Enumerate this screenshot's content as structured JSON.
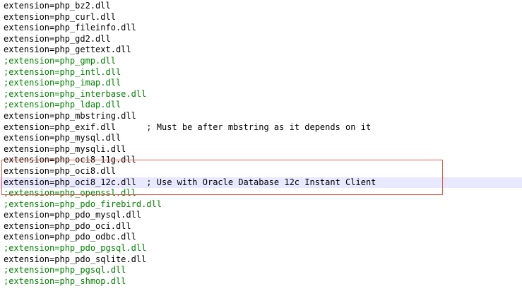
{
  "editor": {
    "lines": [
      {
        "text": "extension=php_bz2.dll",
        "comment": false
      },
      {
        "text": "extension=php_curl.dll",
        "comment": false
      },
      {
        "text": "extension=php_fileinfo.dll",
        "comment": false
      },
      {
        "text": "extension=php_gd2.dll",
        "comment": false
      },
      {
        "text": "extension=php_gettext.dll",
        "comment": false
      },
      {
        "text": ";extension=php_gmp.dll",
        "comment": true
      },
      {
        "text": ";extension=php_intl.dll",
        "comment": true
      },
      {
        "text": ";extension=php_imap.dll",
        "comment": true
      },
      {
        "text": ";extension=php_interbase.dll",
        "comment": true
      },
      {
        "text": ";extension=php_ldap.dll",
        "comment": true
      },
      {
        "text": "extension=php_mbstring.dll",
        "comment": false
      },
      {
        "text": "extension=php_exif.dll      ; Must be after mbstring as it depends on it",
        "comment": false
      },
      {
        "text": "extension=php_mysql.dll",
        "comment": false
      },
      {
        "text": "extension=php_mysqli.dll",
        "comment": false
      },
      {
        "text": "extension=php_oci8_11g.dll",
        "comment": false
      },
      {
        "text": "extension=php_oci8.dll",
        "comment": false
      },
      {
        "text": "extension=php_oci8_12c.dll  ; Use with Oracle Database 12c Instant Client",
        "comment": false,
        "current": true
      },
      {
        "text": ";extension=php_openssl.dll",
        "comment": true
      },
      {
        "text": ";extension=php_pdo_firebird.dll",
        "comment": true
      },
      {
        "text": "extension=php_pdo_mysql.dll",
        "comment": false
      },
      {
        "text": "extension=php_pdo_oci.dll",
        "comment": false
      },
      {
        "text": "extension=php_pdo_odbc.dll",
        "comment": false
      },
      {
        "text": ";extension=php_pdo_pgsql.dll",
        "comment": true
      },
      {
        "text": "extension=php_pdo_sqlite.dll",
        "comment": false
      },
      {
        "text": ";extension=php_pgsql.dll",
        "comment": true
      },
      {
        "text": ";extension=php_shmop.dll",
        "comment": true
      }
    ]
  },
  "colors": {
    "text": "#000000",
    "comment": "#008000",
    "current_line": "#e8e8ff",
    "highlight_border": "#e05a4a"
  }
}
